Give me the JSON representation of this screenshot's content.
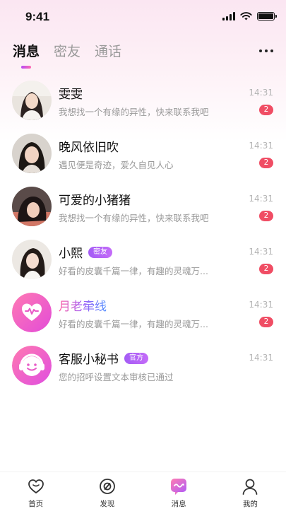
{
  "status_bar": {
    "time": "9:41"
  },
  "tabs": [
    {
      "label": "消息",
      "active": true
    },
    {
      "label": "密友",
      "active": false
    },
    {
      "label": "通话",
      "active": false
    }
  ],
  "conversations": [
    {
      "name": "雯雯",
      "preview": "我想找一个有缘的异性，快来联系我吧",
      "time": "14:31",
      "unread": "2",
      "avatar": "photo-avatar"
    },
    {
      "name": "晚风依旧吹",
      "preview": "遇见便是奇迹，爱久自见人心",
      "time": "14:31",
      "unread": "2",
      "avatar": "photo-avatar"
    },
    {
      "name": "可爱的小猪猪",
      "preview": "我想找一个有缘的异性，快来联系我吧",
      "time": "14:31",
      "unread": "2",
      "avatar": "photo-avatar"
    },
    {
      "name": "小熙",
      "tag": "密友",
      "preview": "好看的皮囊千篇一律，有趣的灵魂万...",
      "time": "14:31",
      "unread": "2",
      "avatar": "photo-avatar"
    },
    {
      "name": "月老牵线",
      "preview": "好看的皮囊千篇一律，有趣的灵魂万...",
      "time": "14:31",
      "unread": "2",
      "avatar": "heart-wave-icon"
    },
    {
      "name": "客服小秘书",
      "tag": "官方",
      "preview": "您的招呼设置文本审核已通过",
      "time": "14:31",
      "avatar": "headset-smile-icon"
    }
  ],
  "bottom_nav": [
    {
      "label": "首页",
      "icon": "heart-icon"
    },
    {
      "label": "发现",
      "icon": "discover-icon"
    },
    {
      "label": "消息",
      "icon": "message-icon",
      "active": true
    },
    {
      "label": "我的",
      "icon": "person-icon"
    }
  ],
  "colors": {
    "accent_gradient_start": "#b84cf5",
    "accent_gradient_end": "#ff6bb0",
    "badge": "#f04d64",
    "tag_purple": "#a45cf5"
  }
}
